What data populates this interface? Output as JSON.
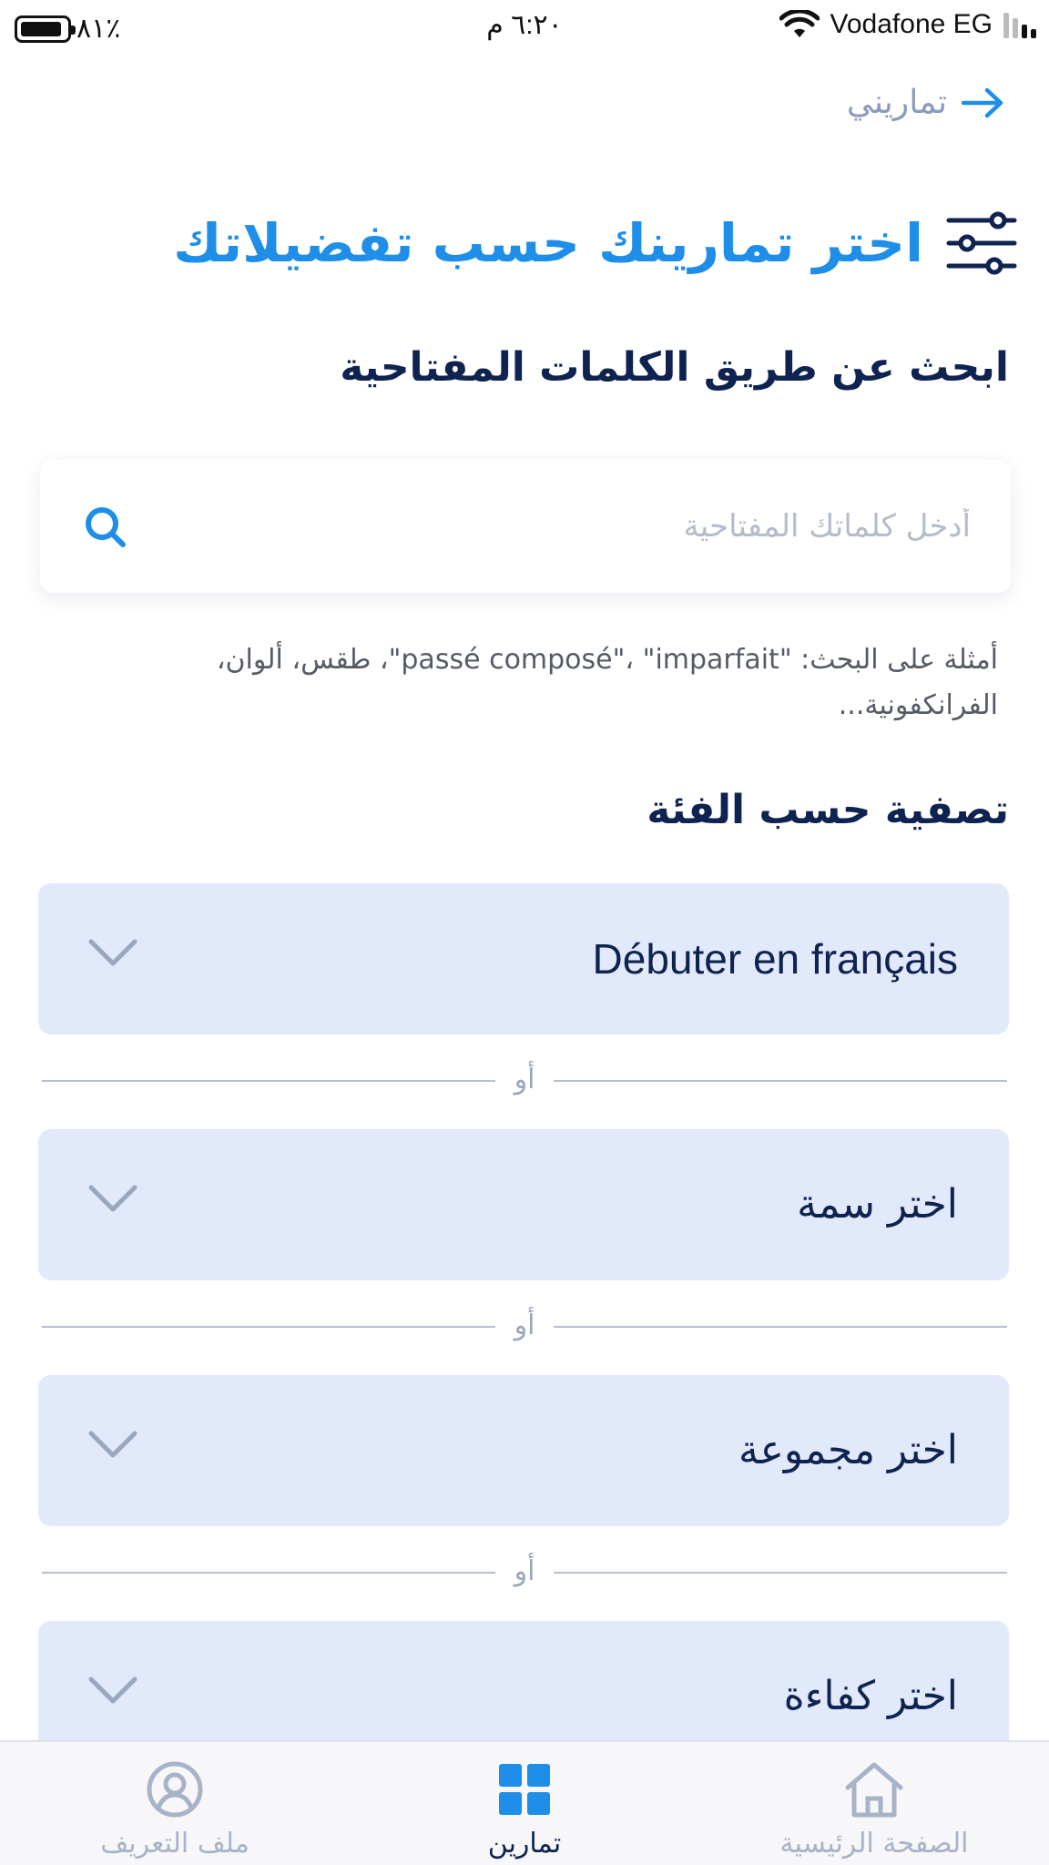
{
  "status_bar": {
    "battery_percent": "٨١٪",
    "battery_level": 0.81,
    "time": "٦:٢٠ م",
    "carrier": "Vodafone EG",
    "signal_bars": 2
  },
  "nav": {
    "back_label": "تماريني",
    "back_icon": "arrow-right-icon"
  },
  "page": {
    "title": "اختر تمارينك حسب تفضيلاتك",
    "title_icon": "sliders-icon"
  },
  "search": {
    "heading": "ابحث عن طريق الكلمات المفتاحية",
    "placeholder": "أدخل كلماتك المفتاحية",
    "value": "",
    "examples": "أمثلة على البحث: \"passé composé\"، \"imparfait\"، طقس، ألوان، الفرانكفونية..."
  },
  "filters": {
    "heading": "تصفية حسب الفئة",
    "separator": "أو",
    "dropdowns": [
      {
        "label": "Débuter en français"
      },
      {
        "label": "اختر سمة"
      },
      {
        "label": "اختر مجموعة"
      },
      {
        "label": "اختر كفاءة"
      }
    ]
  },
  "tab_bar": {
    "tabs": [
      {
        "label": "ملف التعريف",
        "icon": "profile-icon",
        "active": false
      },
      {
        "label": "تمارين",
        "icon": "grid-icon",
        "active": true
      },
      {
        "label": "الصفحة الرئيسية",
        "icon": "home-icon",
        "active": false
      }
    ]
  },
  "colors": {
    "accent": "#1e8ee8",
    "heading": "#0f2350",
    "dropdown_bg": "#e1e9fb",
    "muted": "#a7b3c8"
  }
}
